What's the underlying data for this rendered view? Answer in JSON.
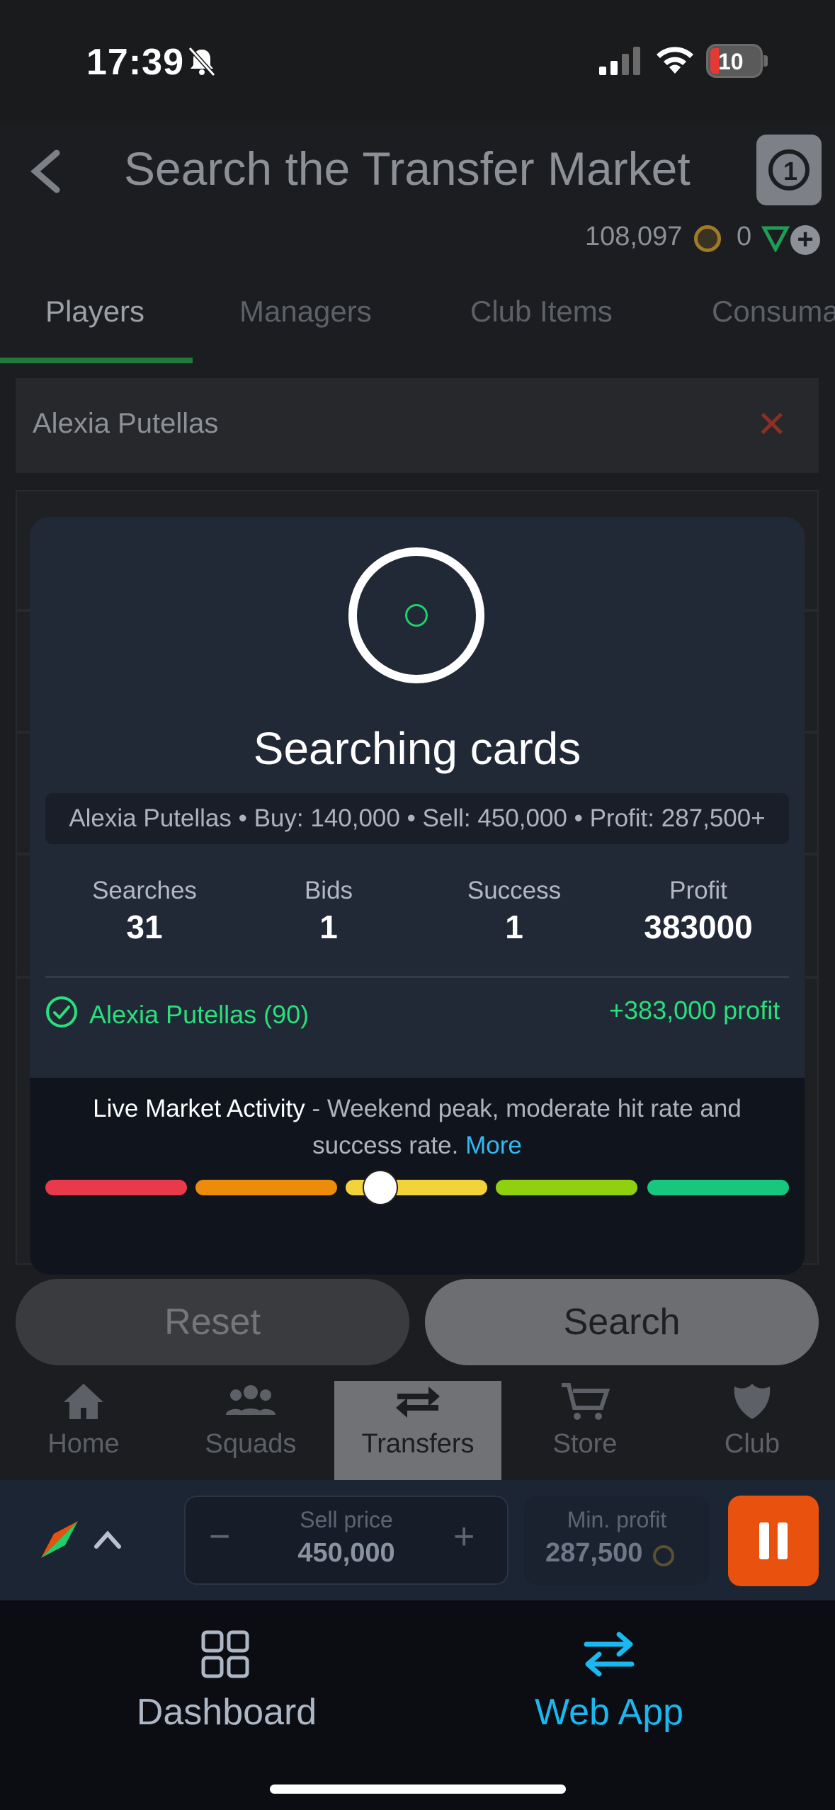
{
  "status_bar": {
    "time": "17:39",
    "battery": "10"
  },
  "header": {
    "title": "Search the Transfer Market",
    "coins": "108,097",
    "points": "0",
    "plus": "+"
  },
  "tabs": [
    "Players",
    "Managers",
    "Club Items",
    "Consuma"
  ],
  "search": {
    "value": "Alexia Putellas",
    "clear": "✕"
  },
  "modal": {
    "title": "Searching cards",
    "summary": "Alexia Putellas • Buy: 140,000 • Sell: 450,000 • Profit: 287,500+",
    "stats": [
      {
        "label": "Searches",
        "value": "31"
      },
      {
        "label": "Bids",
        "value": "1"
      },
      {
        "label": "Success",
        "value": "1"
      },
      {
        "label": "Profit",
        "value": "383000"
      }
    ],
    "hit": {
      "name": "Alexia Putellas (90)",
      "profit": "+383,000 profit"
    },
    "market": {
      "heading": "Live Market Activity",
      "text": " - Weekend peak, moderate hit rate and success rate. ",
      "more": "More",
      "level": 0.45,
      "colors": [
        "#e83a4a",
        "#ec8c0a",
        "#f2d43a",
        "#8fd10f",
        "#17c77f"
      ]
    }
  },
  "buttons": {
    "reset": "Reset",
    "search": "Search"
  },
  "nav": [
    "Home",
    "Squads",
    "Transfers",
    "Store",
    "Club"
  ],
  "toolbar": {
    "sell_label": "Sell price",
    "sell_value": "450,000",
    "minus": "−",
    "plus": "+",
    "min_label": "Min. profit",
    "min_value": "287,500"
  },
  "bottom_tabs": {
    "dashboard": "Dashboard",
    "webapp": "Web App"
  }
}
